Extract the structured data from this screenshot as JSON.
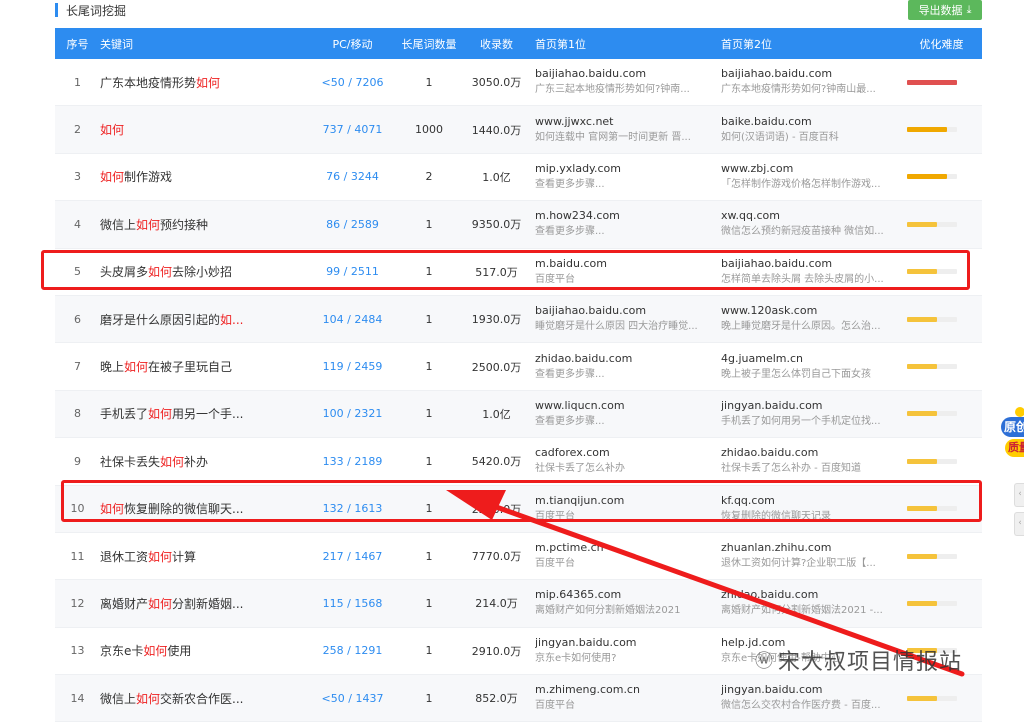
{
  "section": {
    "title": "长尾词挖掘",
    "export_label": "导出数据",
    "export_icon": "download-icon"
  },
  "columns": [
    "序号",
    "关键词",
    "PC/移动",
    "长尾词数量",
    "收录数",
    "首页第1位",
    "首页第2位",
    "优化难度"
  ],
  "colors": {
    "header_bg": "#2d8cf0",
    "highlight": "#ee2222",
    "diff_high": "#e05050",
    "diff_mid": "#f0a800",
    "diff_low": "#f5c33b"
  },
  "rows": [
    {
      "idx": "1",
      "kw_pre": "广东本地疫情形势",
      "kw_hl": "如何",
      "kw_post": "",
      "pc": "<50 / 7206",
      "count": "1",
      "indexed": "3050.0万",
      "s1_domain": "baijiahao.baidu.com",
      "s1_desc": "广东三起本地疫情形势如何?钟南...",
      "s2_domain": "baijiahao.baidu.com",
      "s2_desc": "广东本地疫情形势如何?钟南山最...",
      "difficulty": 1.0,
      "diff_color": "#e05050"
    },
    {
      "idx": "2",
      "kw_pre": "",
      "kw_hl": "如何",
      "kw_post": "",
      "pc": "737 / 4071",
      "count": "1000",
      "indexed": "1440.0万",
      "s1_domain": "www.jjwxc.net",
      "s1_desc": "如何连载中 官网第一时间更新 晋...",
      "s2_domain": "baike.baidu.com",
      "s2_desc": "如何(汉语词语) - 百度百科",
      "difficulty": 0.8,
      "diff_color": "#f0a800"
    },
    {
      "idx": "3",
      "kw_pre": "",
      "kw_hl": "如何",
      "kw_post": "制作游戏",
      "pc": "76 / 3244",
      "count": "2",
      "indexed": "1.0亿",
      "s1_domain": "mip.yxlady.com",
      "s1_desc": "查看更多步骤...",
      "s2_domain": "www.zbj.com",
      "s2_desc": "「怎样制作游戏价格怎样制作游戏...",
      "difficulty": 0.8,
      "diff_color": "#f0a800"
    },
    {
      "idx": "4",
      "kw_pre": "微信上",
      "kw_hl": "如何",
      "kw_post": "预约接种",
      "pc": "86 / 2589",
      "count": "1",
      "indexed": "9350.0万",
      "s1_domain": "m.how234.com",
      "s1_desc": "查看更多步骤...",
      "s2_domain": "xw.qq.com",
      "s2_desc": "微信怎么预约新冠疫苗接种 微信如...",
      "difficulty": 0.6,
      "diff_color": "#f5c33b"
    },
    {
      "idx": "5",
      "kw_pre": "头皮屑多",
      "kw_hl": "如何",
      "kw_post": "去除小妙招",
      "pc": "99 / 2511",
      "count": "1",
      "indexed": "517.0万",
      "s1_domain": "m.baidu.com",
      "s1_desc": "百度平台",
      "s2_domain": "baijiahao.baidu.com",
      "s2_desc": "怎样简单去除头屑 去除头皮屑的小...",
      "difficulty": 0.6,
      "diff_color": "#f5c33b"
    },
    {
      "idx": "6",
      "kw_pre": "磨牙是什么原因引起的",
      "kw_hl": "如...",
      "kw_post": "",
      "pc": "104 / 2484",
      "count": "1",
      "indexed": "1930.0万",
      "s1_domain": "baijiahao.baidu.com",
      "s1_desc": "睡觉磨牙是什么原因 四大治疗睡觉...",
      "s2_domain": "www.120ask.com",
      "s2_desc": "晚上睡觉磨牙是什么原因。怎么治...",
      "difficulty": 0.6,
      "diff_color": "#f5c33b"
    },
    {
      "idx": "7",
      "kw_pre": "晚上",
      "kw_hl": "如何",
      "kw_post": "在被子里玩自己",
      "pc": "119 / 2459",
      "count": "1",
      "indexed": "2500.0万",
      "s1_domain": "zhidao.baidu.com",
      "s1_desc": "查看更多步骤...",
      "s2_domain": "4g.juamelm.cn",
      "s2_desc": "晚上被子里怎么体罚自己下面女孩",
      "difficulty": 0.6,
      "diff_color": "#f5c33b"
    },
    {
      "idx": "8",
      "kw_pre": "手机丢了",
      "kw_hl": "如何",
      "kw_post": "用另一个手...",
      "pc": "100 / 2321",
      "count": "1",
      "indexed": "1.0亿",
      "s1_domain": "www.liqucn.com",
      "s1_desc": "查看更多步骤...",
      "s2_domain": "jingyan.baidu.com",
      "s2_desc": "手机丢了如何用另一个手机定位找...",
      "difficulty": 0.6,
      "diff_color": "#f5c33b"
    },
    {
      "idx": "9",
      "kw_pre": "社保卡丢失",
      "kw_hl": "如何",
      "kw_post": "补办",
      "pc": "133 / 2189",
      "count": "1",
      "indexed": "5420.0万",
      "s1_domain": "cadforex.com",
      "s1_desc": "社保卡丢了怎么补办",
      "s2_domain": "zhidao.baidu.com",
      "s2_desc": "社保卡丢了怎么补办 - 百度知道",
      "difficulty": 0.6,
      "diff_color": "#f5c33b"
    },
    {
      "idx": "10",
      "kw_pre": "",
      "kw_hl": "如何",
      "kw_post": "恢复删除的微信聊天...",
      "pc": "132 / 1613",
      "count": "1",
      "indexed": "2240.0万",
      "s1_domain": "m.tianqijun.com",
      "s1_desc": "百度平台",
      "s2_domain": "kf.qq.com",
      "s2_desc": "恢复删除的微信聊天记录",
      "difficulty": 0.6,
      "diff_color": "#f5c33b"
    },
    {
      "idx": "11",
      "kw_pre": "退休工资",
      "kw_hl": "如何",
      "kw_post": "计算",
      "pc": "217 / 1467",
      "count": "1",
      "indexed": "7770.0万",
      "s1_domain": "m.pctime.cn",
      "s1_desc": "百度平台",
      "s2_domain": "zhuanlan.zhihu.com",
      "s2_desc": "退休工资如何计算?企业职工版【...",
      "difficulty": 0.6,
      "diff_color": "#f5c33b"
    },
    {
      "idx": "12",
      "kw_pre": "离婚财产",
      "kw_hl": "如何",
      "kw_post": "分割新婚姻...",
      "pc": "115 / 1568",
      "count": "1",
      "indexed": "214.0万",
      "s1_domain": "mip.64365.com",
      "s1_desc": "离婚财产如何分割新婚姻法2021",
      "s2_domain": "zhidao.baidu.com",
      "s2_desc": "离婚财产如何分割新婚姻法2021 -...",
      "difficulty": 0.6,
      "diff_color": "#f5c33b"
    },
    {
      "idx": "13",
      "kw_pre": "京东e卡",
      "kw_hl": "如何",
      "kw_post": "使用",
      "pc": "258 / 1291",
      "count": "1",
      "indexed": "2910.0万",
      "s1_domain": "jingyan.baidu.com",
      "s1_desc": "京东e卡如何使用?",
      "s2_domain": "help.jd.com",
      "s2_desc": "京东e卡如何使用-帮助中心",
      "difficulty": 0.6,
      "diff_color": "#f5c33b"
    },
    {
      "idx": "14",
      "kw_pre": "微信上",
      "kw_hl": "如何",
      "kw_post": "交新农合作医...",
      "pc": "<50 / 1437",
      "count": "1",
      "indexed": "852.0万",
      "s1_domain": "m.zhimeng.com.cn",
      "s1_desc": "百度平台",
      "s2_domain": "jingyan.baidu.com",
      "s2_desc": "微信怎么交农村合作医疗费 - 百度...",
      "difficulty": 0.6,
      "diff_color": "#f5c33b"
    }
  ],
  "watermark": {
    "text": "宋大叔项目情报站",
    "icon": "wechat-icon"
  },
  "side_float": {
    "line1": "原创",
    "line2": "质量"
  }
}
